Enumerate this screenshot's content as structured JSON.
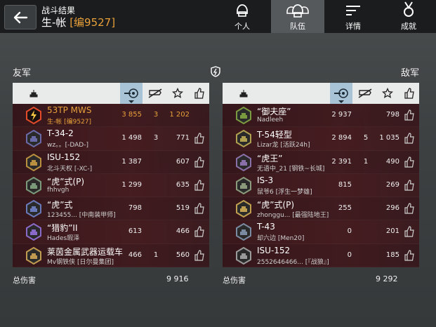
{
  "header": {
    "title": "战斗结果",
    "player_name": "生-帐",
    "player_tag": "[编9527]",
    "tabs": [
      {
        "label": "个人",
        "icon": "single-helmet-icon",
        "active": false
      },
      {
        "label": "队伍",
        "icon": "team-helmet-icon",
        "active": true
      },
      {
        "label": "详情",
        "icon": "list-icon",
        "active": false
      },
      {
        "label": "成就",
        "icon": "medal-icon",
        "active": false
      }
    ]
  },
  "allies": {
    "label": "友军",
    "total_label": "总伤害",
    "total_value": "9 916",
    "rows": [
      {
        "tank": "53TP MWS",
        "player": "生-帐 [编9527]",
        "damage": "3 855",
        "kills": "3",
        "score": "1 202",
        "me": true
      },
      {
        "tank": "T-34-2",
        "player": "wz。。[-DAD-]",
        "damage": "1 498",
        "kills": "3",
        "score": "771",
        "me": false
      },
      {
        "tank": "ISU-152",
        "player": "北斗天权 [-XC-]",
        "damage": "1 387",
        "kills": "",
        "score": "607",
        "me": false
      },
      {
        "tank": "“虎”式(P)",
        "player": "fhhvgh",
        "damage": "1 299",
        "kills": "",
        "score": "635",
        "me": false
      },
      {
        "tank": "“虎”式",
        "player": "123455... [中南装甲师]",
        "damage": "798",
        "kills": "",
        "score": "519",
        "me": false
      },
      {
        "tank": "“猎豹”II",
        "player": "Hades瑕泽",
        "damage": "613",
        "kills": "",
        "score": "466",
        "me": false
      },
      {
        "tank": "莱茵金属武器运载车",
        "player": "Mv钢铁侠 [日尔曼集团]",
        "damage": "466",
        "kills": "1",
        "score": "560",
        "me": false
      }
    ]
  },
  "enemies": {
    "label": "敌军",
    "total_label": "总伤害",
    "total_value": "9 292",
    "rows": [
      {
        "tank": "“御夫座”",
        "player": "Nadleeh",
        "damage": "2 937",
        "kills": "",
        "score": "798"
      },
      {
        "tank": "T-54轻型",
        "player": "Lizar龙 [活跃24h]",
        "damage": "2 894",
        "kills": "5",
        "score": "1 035"
      },
      {
        "tank": "“虎王”",
        "player": "无语中_21 [钢铁~长城]",
        "damage": "2 391",
        "kills": "1",
        "score": "490"
      },
      {
        "tank": "IS-3",
        "player": "鼠爷6 [浮生一梦雄]",
        "damage": "815",
        "kills": "",
        "score": "269"
      },
      {
        "tank": "“虎”式(P)",
        "player": "zhonggu... [最强陆地王]",
        "damage": "255",
        "kills": "",
        "score": "296"
      },
      {
        "tank": "T-43",
        "player": "却六边 [Men20]",
        "damage": "0",
        "kills": "",
        "score": "201"
      },
      {
        "tank": "ISU-152",
        "player": "2552646466... [『战狼』]",
        "damage": "0",
        "kills": "",
        "score": "185"
      }
    ]
  },
  "colors": {
    "accent": "#e8a03a",
    "sort_header": "#a8c3d6",
    "row": "#3a161a"
  }
}
